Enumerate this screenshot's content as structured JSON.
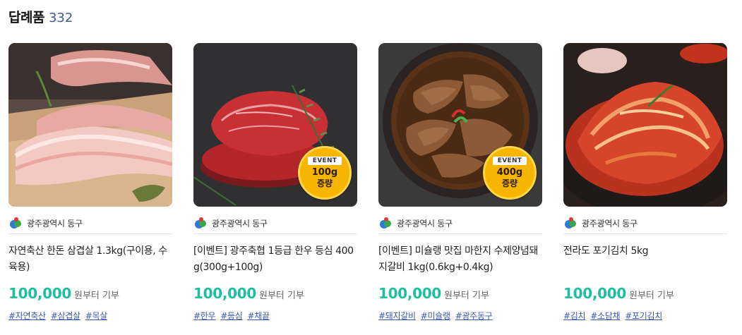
{
  "section": {
    "title": "답례품",
    "count": "332"
  },
  "products": [
    {
      "region": "광주광역시 동구",
      "name": "자연축산 한돈 삼겹살 1.3kg(구이용, 수육용)",
      "price": "100,000",
      "price_suffix": "원부터 기부",
      "tags": [
        "#자연축산",
        "#삼겹살",
        "#목살"
      ],
      "badge": null
    },
    {
      "region": "광주광역시 동구",
      "name": "[이벤트] 광주축협 1등급 한우 등심 400g(300g+100g)",
      "price": "100,000",
      "price_suffix": "원부터 기부",
      "tags": [
        "#한우",
        "#등심",
        "#채끝"
      ],
      "badge": {
        "label": "EVENT",
        "amount": "100g",
        "text": "증량"
      }
    },
    {
      "region": "광주광역시 동구",
      "name": "[이벤트] 미슐랭 맛집 마한지 수제양념돼지갈비 1kg(0.6kg+0.4kg)",
      "price": "100,000",
      "price_suffix": "원부터 기부",
      "tags": [
        "#돼지갈비",
        "#미슐랭",
        "#광주동구"
      ],
      "badge": {
        "label": "EVENT",
        "amount": "400g",
        "text": "증량"
      }
    },
    {
      "region": "광주광역시 동구",
      "name": "전라도 포기김치 5kg",
      "price": "100,000",
      "price_suffix": "원부터 기부",
      "tags": [
        "#김치",
        "#소담채",
        "#포기김치"
      ],
      "badge": null
    }
  ],
  "colors": {
    "price": "#1cbf9f",
    "tag": "#3b5aa8",
    "count": "#3d5a99",
    "badge": "#f7b500"
  }
}
